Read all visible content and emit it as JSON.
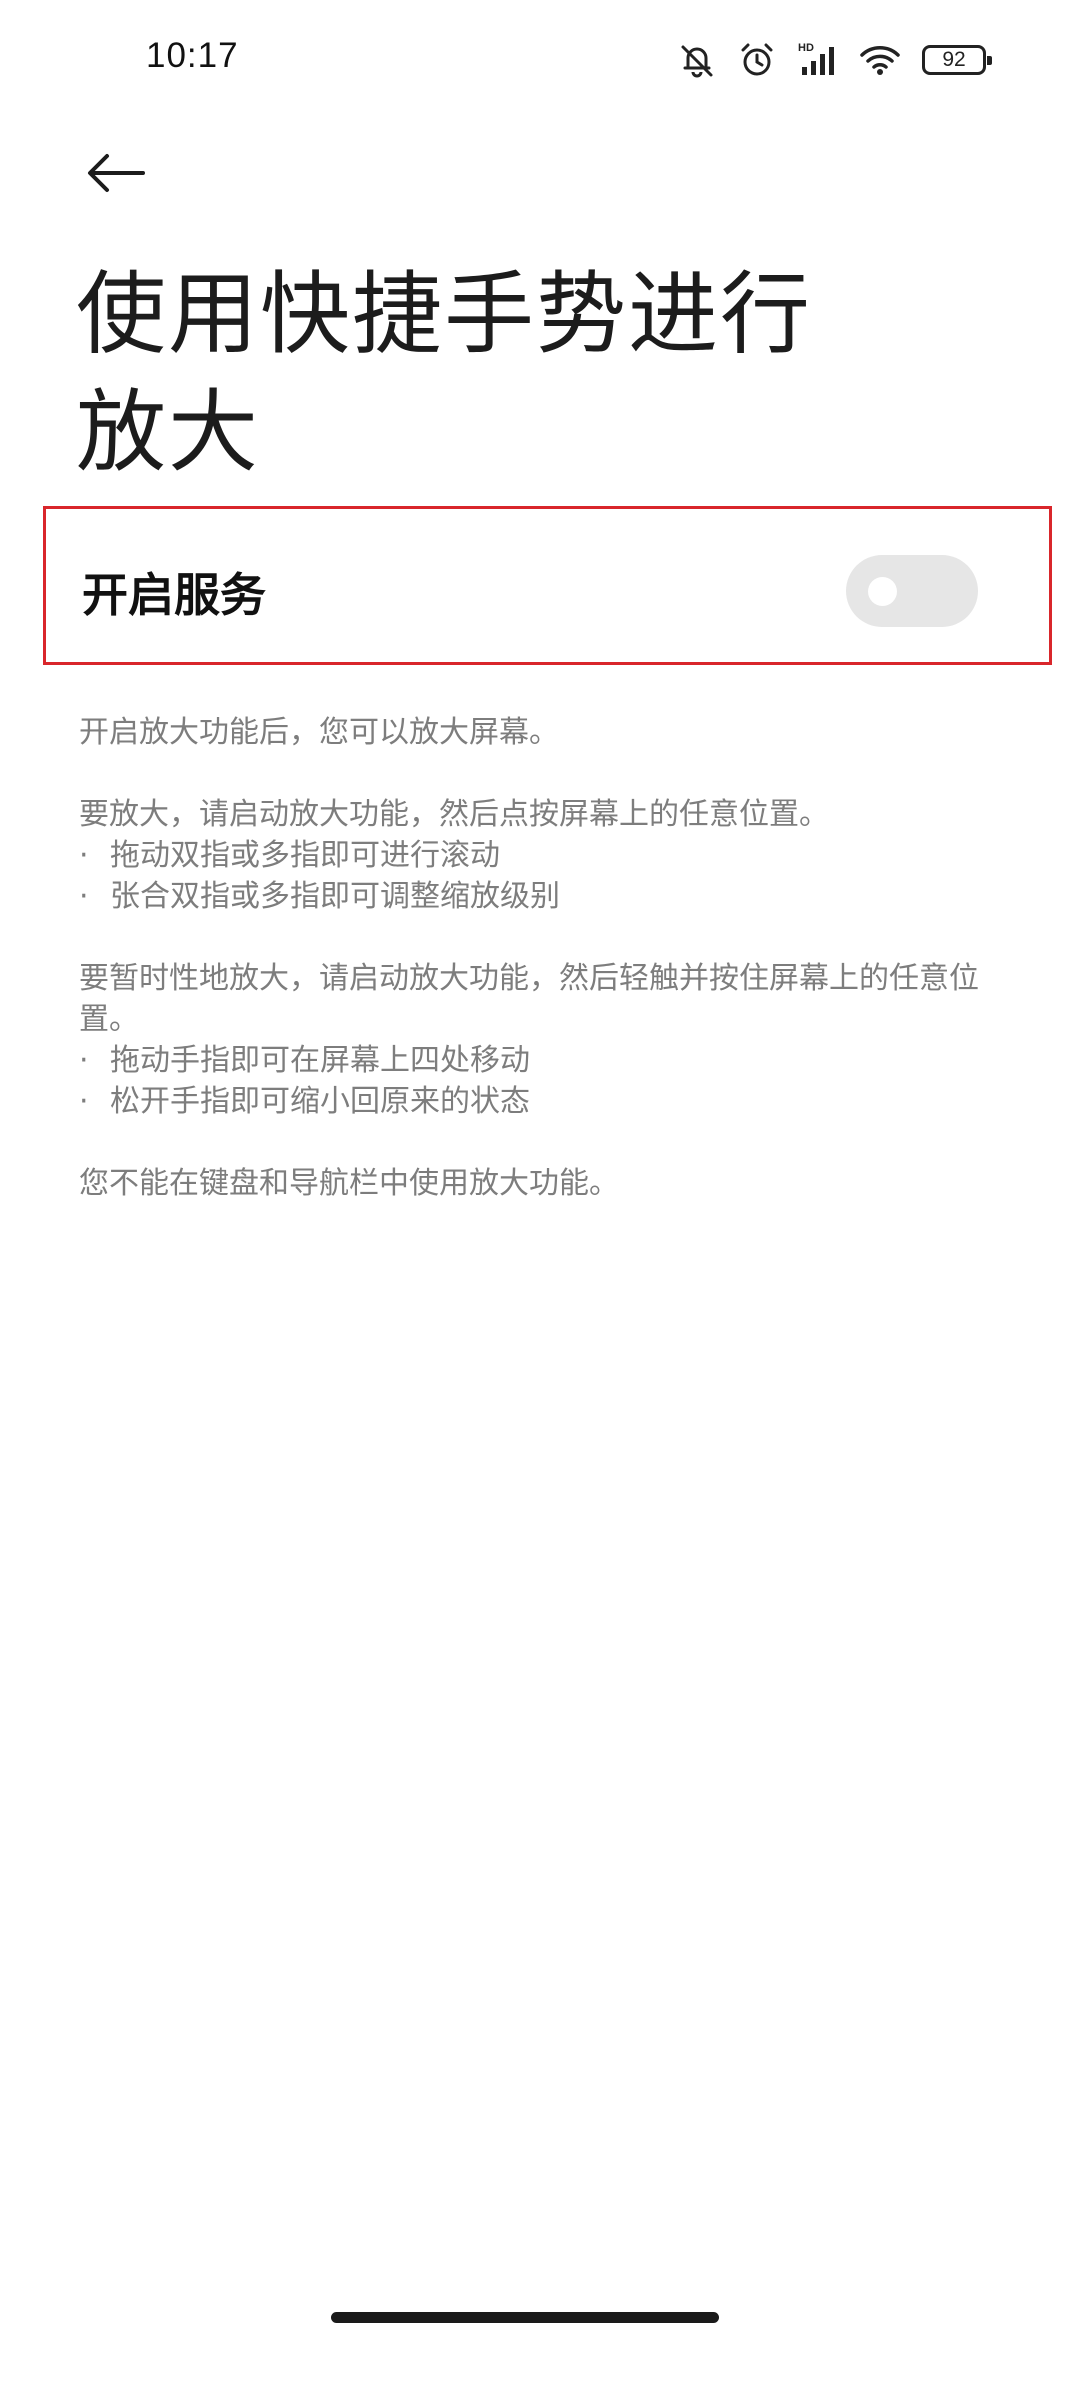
{
  "status_bar": {
    "time": "10:17",
    "network_label": "HD",
    "battery": "92",
    "icons": [
      "mute-bell-icon",
      "alarm-icon",
      "signal-icon",
      "wifi-icon",
      "battery-icon"
    ]
  },
  "header": {
    "back_icon": "arrow-left-icon",
    "title": "使用快捷手势进行放大"
  },
  "service": {
    "label": "开启服务",
    "toggle_on": false
  },
  "description": {
    "intro": "开启放大功能后，您可以放大屏幕。",
    "zoom_instruction": "要放大，请启动放大功能，然后点按屏幕上的任意位置。",
    "zoom_bullets": [
      "拖动双指或多指即可进行滚动",
      "张合双指或多指即可调整缩放级别"
    ],
    "temp_instruction": "要暂时性地放大，请启动放大功能，然后轻触并按住屏幕上的任意位置。",
    "temp_bullets": [
      "拖动手指即可在屏幕上四处移动",
      "松开手指即可缩小回原来的状态"
    ],
    "note": "您不能在键盘和导航栏中使用放大功能。",
    "bullet_char": "·"
  },
  "colors": {
    "highlight_border": "#d9262b",
    "toggle_track": "#e6e6e6",
    "secondary_text": "#7d7d7d"
  }
}
